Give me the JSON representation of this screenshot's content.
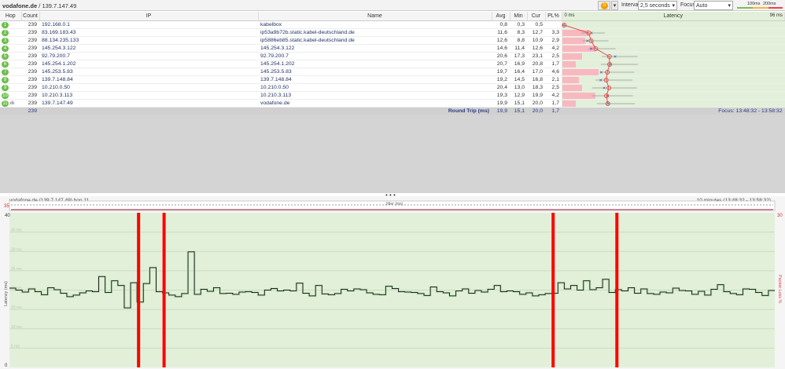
{
  "toolbar": {
    "target": "vodafone.de",
    "target_ip": "/ 139.7.147.49",
    "interval_label": "Interval",
    "interval_value": "2,5 seconds",
    "focus_label": "Focus",
    "focus_value": "Auto",
    "threshold_1": "100ms",
    "threshold_2": "200ms"
  },
  "colors": {
    "good": "#7cc04c",
    "warn": "#f5b642",
    "bad": "#ee4444",
    "loss": "#ff0000",
    "bg": "#e2f0d9"
  },
  "columns": {
    "hop": "Hop",
    "count": "Count",
    "ip": "IP",
    "name": "Name",
    "avg": "Avg",
    "min": "Min",
    "cur": "Cur",
    "pl": "PL%",
    "latency": "Latency",
    "lat_min": "0 ms",
    "lat_max": "96 ms"
  },
  "hops": [
    {
      "hop": "1",
      "count": "239",
      "ip": "192.168.0.1",
      "name": "kabelbox",
      "avg": "0,8",
      "min": "0,3",
      "cur": "0,5",
      "pl": ""
    },
    {
      "hop": "2",
      "count": "239",
      "ip": "83.169.183.43",
      "name": "ip53a9b72b.static.kabel-deutschland.de",
      "avg": "11,6",
      "min": "8,3",
      "cur": "12,7",
      "pl": "3,3"
    },
    {
      "hop": "3",
      "count": "239",
      "ip": "88.134.235.133",
      "name": "ip5886eb85.static.kabel-deutschland.de",
      "avg": "12,6",
      "min": "8,8",
      "cur": "10,9",
      "pl": "2,9"
    },
    {
      "hop": "4",
      "count": "239",
      "ip": "145.254.3.122",
      "name": "145.254.3.122",
      "avg": "14,6",
      "min": "11,4",
      "cur": "12,6",
      "pl": "4,2"
    },
    {
      "hop": "5",
      "count": "239",
      "ip": "92.79.200.7",
      "name": "92.79.200.7",
      "avg": "20,6",
      "min": "17,3",
      "cur": "23,1",
      "pl": "2,5"
    },
    {
      "hop": "6",
      "count": "239",
      "ip": "145.254.1.202",
      "name": "145.254.1.202",
      "avg": "20,7",
      "min": "16,9",
      "cur": "20,8",
      "pl": "1,7"
    },
    {
      "hop": "7",
      "count": "239",
      "ip": "145.253.5.83",
      "name": "145.253.5.83",
      "avg": "19,7",
      "min": "16,4",
      "cur": "17,0",
      "pl": "4,6"
    },
    {
      "hop": "8",
      "count": "239",
      "ip": "139.7.148.84",
      "name": "139.7.148.84",
      "avg": "19,2",
      "min": "14,5",
      "cur": "16,8",
      "pl": "2,1"
    },
    {
      "hop": "9",
      "count": "239",
      "ip": "10.210.0.50",
      "name": "10.210.0.50",
      "avg": "20,4",
      "min": "13,0",
      "cur": "18,3",
      "pl": "2,5"
    },
    {
      "hop": "10",
      "count": "239",
      "ip": "10.210.3.113",
      "name": "10.210.3.113",
      "avg": "19,3",
      "min": "12,9",
      "cur": "19,9",
      "pl": "4,2"
    },
    {
      "hop": "11",
      "count": "239",
      "ip": "139.7.147.49",
      "name": "vodafone.de",
      "avg": "19,9",
      "min": "15,1",
      "cur": "20,0",
      "pl": "1,7"
    }
  ],
  "footer": {
    "count": "239",
    "label": "Round Trip (ms)",
    "avg": "19,9",
    "min": "15,1",
    "cur": "20,0",
    "pl": "1,7",
    "focus": "Focus: 13:48:32 - 13:58:32"
  },
  "lower": {
    "title": "vodafone.de (139.7.147.49) hop 11",
    "range": "10 minutes (13:48:32 - 13:58:32)",
    "jitter_label": "Jitter (ms)",
    "jitter_max": "35"
  },
  "chart_data": {
    "type": "line",
    "title": "vodafone.de (139.7.147.49) hop 11",
    "ylabel": "Latency (ms)",
    "y2label": "Packet Loss %",
    "ylim": [
      0,
      40
    ],
    "y2max": "30",
    "ytick_labels": [
      "40",
      "35 ms",
      "30 ms",
      "25 ms",
      "20 ms",
      "15 ms",
      "10 ms",
      "5 ms",
      "0"
    ],
    "values": [
      20.5,
      20,
      19.5,
      20.3,
      19.6,
      18.8,
      20.6,
      20.1,
      19.2,
      18.3,
      18.7,
      19.3,
      19.8,
      19.6,
      23.5,
      19.4,
      22.4,
      21.2,
      15.4,
      21.9,
      16.9,
      21.7,
      25.8,
      19.6,
      19.3,
      18.7,
      18.3,
      19.1,
      29.9,
      18.9,
      20.2,
      19.7,
      20.6,
      19.1,
      19.2,
      18.9,
      19.5,
      19.6,
      19.4,
      18.7,
      20,
      20.4,
      19.8,
      20,
      19.8,
      21.8,
      19.2,
      18.5,
      21.2,
      19,
      18.8,
      19.1,
      20.2,
      19.8,
      20.3,
      20.1,
      19.3,
      18.9,
      18.8,
      21,
      20.4,
      19.6,
      19.5,
      19.4,
      19.1,
      18.6,
      20.8,
      19.6,
      19.3,
      18.5,
      19.8,
      20.3,
      19.2,
      19.9,
      19.5,
      20.2,
      21.2,
      19.6,
      19.8,
      19.6,
      18.9,
      19.3,
      18.5,
      18.8,
      19.1,
      19.2,
      21.9,
      20.3,
      21.2,
      20,
      22.4,
      20.1,
      20.6,
      22.8,
      19.4,
      20.1,
      19.8,
      20.6,
      19.2,
      20.3,
      19.1,
      18.9,
      19.5,
      19.3,
      20.5,
      19.9,
      19.8,
      18.9,
      19.7,
      18.7,
      20.2,
      21.4,
      19.6,
      19.1,
      18.8,
      20.3,
      20.2,
      19.4,
      18.6,
      19.9
    ],
    "loss_indices": [
      20,
      24,
      85,
      95
    ]
  }
}
